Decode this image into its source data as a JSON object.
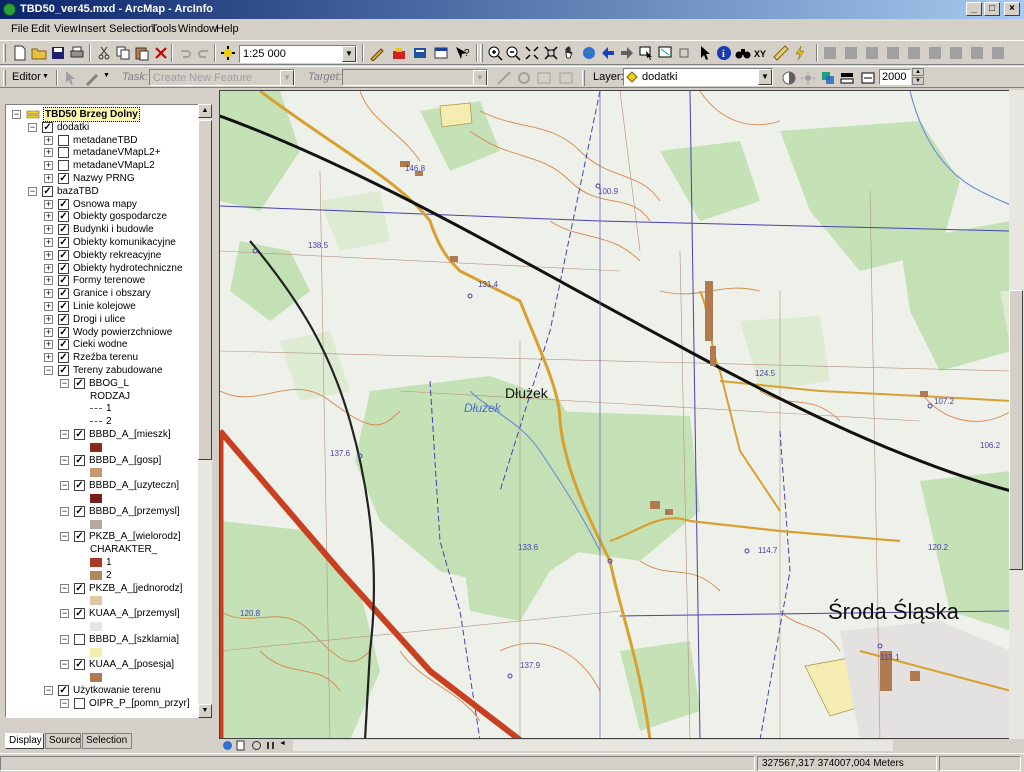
{
  "window": {
    "title": "TBD50_ver45.mxd - ArcMap - ArcInfo"
  },
  "menu": [
    "File",
    "Edit",
    "View",
    "Insert",
    "Selection",
    "Tools",
    "Window",
    "Help"
  ],
  "toolbar": {
    "scale": "1:25 000"
  },
  "editor": {
    "editor_label": "Editor",
    "task_label": "Task:",
    "task_value": "Create New Feature",
    "target_label": "Target:",
    "target_value": "",
    "layer_label": "Layer:",
    "layer_value": "dodatki",
    "number_value": "2000"
  },
  "toc": {
    "rows": [
      {
        "level": 0,
        "expand": "minus",
        "check": null,
        "label": "TBD50 Brzeg Dolny",
        "type": "frame"
      },
      {
        "level": 1,
        "expand": "minus",
        "check": true,
        "label": "dodatki",
        "type": "group"
      },
      {
        "level": 2,
        "expand": "plus",
        "check": false,
        "label": "metadaneTBD",
        "type": "layer"
      },
      {
        "level": 2,
        "expand": "plus",
        "check": false,
        "label": "metadaneVMapL2+",
        "type": "layer"
      },
      {
        "level": 2,
        "expand": "plus",
        "check": false,
        "label": "metadaneVMapL2",
        "type": "layer"
      },
      {
        "level": 2,
        "expand": "plus",
        "check": true,
        "label": "Nazwy PRNG",
        "type": "layer"
      },
      {
        "level": 1,
        "expand": "minus",
        "check": true,
        "label": "bazaTBD",
        "type": "group"
      },
      {
        "level": 2,
        "expand": "plus",
        "check": true,
        "label": "Osnowa mapy",
        "type": "layer"
      },
      {
        "level": 2,
        "expand": "plus",
        "check": true,
        "label": "Obiekty gospodarcze",
        "type": "layer"
      },
      {
        "level": 2,
        "expand": "plus",
        "check": true,
        "label": "Budynki i budowle",
        "type": "layer"
      },
      {
        "level": 2,
        "expand": "plus",
        "check": true,
        "label": "Obiekty komunikacyjne",
        "type": "layer"
      },
      {
        "level": 2,
        "expand": "plus",
        "check": true,
        "label": "Obiekty rekreacyjne",
        "type": "layer"
      },
      {
        "level": 2,
        "expand": "plus",
        "check": true,
        "label": "Obiekty hydrotechniczne",
        "type": "layer"
      },
      {
        "level": 2,
        "expand": "plus",
        "check": true,
        "label": "Formy terenowe",
        "type": "layer"
      },
      {
        "level": 2,
        "expand": "plus",
        "check": true,
        "label": "Granice i obszary",
        "type": "layer"
      },
      {
        "level": 2,
        "expand": "plus",
        "check": true,
        "label": "Linie kolejowe",
        "type": "layer"
      },
      {
        "level": 2,
        "expand": "plus",
        "check": true,
        "label": "Drogi i ulice",
        "type": "layer"
      },
      {
        "level": 2,
        "expand": "plus",
        "check": true,
        "label": "Wody powierzchniowe",
        "type": "layer"
      },
      {
        "level": 2,
        "expand": "plus",
        "check": true,
        "label": "Cieki wodne",
        "type": "layer"
      },
      {
        "level": 2,
        "expand": "plus",
        "check": true,
        "label": "Rzeźba terenu",
        "type": "layer"
      },
      {
        "level": 2,
        "expand": "minus",
        "check": true,
        "label": "Tereny zabudowane",
        "type": "layer"
      },
      {
        "level": 3,
        "expand": "minus",
        "check": true,
        "label": "BBOG_L",
        "type": "sublayer"
      },
      {
        "level": 4,
        "expand": null,
        "check": null,
        "label": "RODZAJ",
        "type": "field"
      },
      {
        "level": 4,
        "expand": null,
        "check": null,
        "label": "1",
        "type": "legend",
        "swatch": "#606060",
        "shape": "line"
      },
      {
        "level": 4,
        "expand": null,
        "check": null,
        "label": "2",
        "type": "legend",
        "swatch": "#606060",
        "shape": "line"
      },
      {
        "level": 3,
        "expand": "minus",
        "check": true,
        "label": "BBBD_A_[mieszk]",
        "type": "sublayer"
      },
      {
        "level": 4,
        "expand": null,
        "check": null,
        "label": "",
        "type": "legend",
        "swatch": "#8b2a1e",
        "shape": "box"
      },
      {
        "level": 3,
        "expand": "minus",
        "check": true,
        "label": "BBBD_A_[gosp]",
        "type": "sublayer"
      },
      {
        "level": 4,
        "expand": null,
        "check": null,
        "label": "",
        "type": "legend",
        "swatch": "#c49a76",
        "shape": "box"
      },
      {
        "level": 3,
        "expand": "minus",
        "check": true,
        "label": "BBBD_A_[uzyteczn]",
        "type": "sublayer"
      },
      {
        "level": 4,
        "expand": null,
        "check": null,
        "label": "",
        "type": "legend",
        "swatch": "#7a1e18",
        "shape": "box"
      },
      {
        "level": 3,
        "expand": "minus",
        "check": true,
        "label": "BBBD_A_[przemysl]",
        "type": "sublayer"
      },
      {
        "level": 4,
        "expand": null,
        "check": null,
        "label": "",
        "type": "legend",
        "swatch": "#b8a8a0",
        "shape": "box"
      },
      {
        "level": 3,
        "expand": "minus",
        "check": true,
        "label": "PKZB_A_[wielorodz]",
        "type": "sublayer"
      },
      {
        "level": 4,
        "expand": null,
        "check": null,
        "label": "CHARAKTER_",
        "type": "field"
      },
      {
        "level": 4,
        "expand": null,
        "check": null,
        "label": "1",
        "type": "legend",
        "swatch": "#a83a26",
        "shape": "box"
      },
      {
        "level": 4,
        "expand": null,
        "check": null,
        "label": "2",
        "type": "legend",
        "swatch": "#b08a5a",
        "shape": "box"
      },
      {
        "level": 3,
        "expand": "minus",
        "check": true,
        "label": "PKZB_A_[jednorodz]",
        "type": "sublayer"
      },
      {
        "level": 4,
        "expand": null,
        "check": null,
        "label": "",
        "type": "legend",
        "swatch": "#dcc8a8",
        "shape": "box"
      },
      {
        "level": 3,
        "expand": "minus",
        "check": true,
        "label": "KUAA_A_[przemysl]",
        "type": "sublayer"
      },
      {
        "level": 4,
        "expand": null,
        "check": null,
        "label": "",
        "type": "legend",
        "swatch": "#e8e6e2",
        "shape": "box"
      },
      {
        "level": 3,
        "expand": "minus",
        "check": false,
        "label": "BBBD_A_[szklarnia]",
        "type": "sublayer"
      },
      {
        "level": 4,
        "expand": null,
        "check": null,
        "label": "",
        "type": "legend",
        "swatch": "#f4ecb0",
        "shape": "box"
      },
      {
        "level": 3,
        "expand": "minus",
        "check": true,
        "label": "KUAA_A_[posesja]",
        "type": "sublayer"
      },
      {
        "level": 4,
        "expand": null,
        "check": null,
        "label": "",
        "type": "legend",
        "swatch": "#b07a50",
        "shape": "box"
      },
      {
        "level": 2,
        "expand": "minus",
        "check": true,
        "label": "Użytkowanie terenu",
        "type": "layer"
      },
      {
        "level": 3,
        "expand": "minus",
        "check": false,
        "label": "OIPR_P_[pomn_przyr]",
        "type": "sublayer"
      }
    ]
  },
  "tabs": [
    "Display",
    "Source",
    "Selection"
  ],
  "map": {
    "places": [
      {
        "name": "Dłużek",
        "style": "town"
      },
      {
        "name": "Dłużek",
        "style": "water"
      },
      {
        "name": "Środa Śląska",
        "style": "city"
      }
    ],
    "elevations": [
      "146.8",
      "100.9",
      "138.5",
      "131.4",
      "124.5",
      "107.2",
      "106.2",
      "137.6",
      "133.6",
      "114.7",
      "120.8",
      "137.9",
      "113.1",
      "120.2"
    ]
  },
  "status": {
    "coords": "327567,317  374007,004 Meters"
  }
}
